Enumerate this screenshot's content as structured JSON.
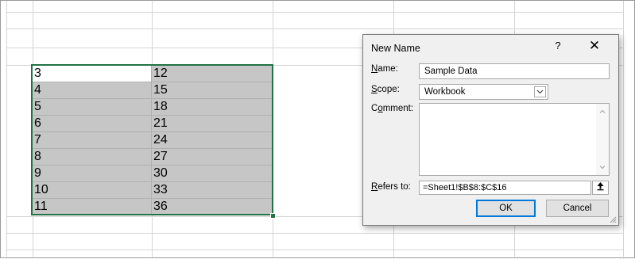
{
  "sheet": {
    "rows": [
      {
        "b": "3",
        "c": "12"
      },
      {
        "b": "4",
        "c": "15"
      },
      {
        "b": "5",
        "c": "18"
      },
      {
        "b": "6",
        "c": "21"
      },
      {
        "b": "7",
        "c": "24"
      },
      {
        "b": "8",
        "c": "27"
      },
      {
        "b": "9",
        "c": "30"
      },
      {
        "b": "10",
        "c": "33"
      },
      {
        "b": "11",
        "c": "36"
      }
    ]
  },
  "dialog": {
    "title": "New Name",
    "help": "?",
    "close": "✕",
    "name_label": "Name:",
    "name_value": "Sample Data",
    "scope_label": "Scope:",
    "scope_value": "Workbook",
    "comment_label": "Comment:",
    "comment_value": "",
    "refers_label": "Refers to:",
    "refers_value": "=Sheet1!$B$8:$C$16",
    "ok_label": "OK",
    "cancel_label": "Cancel"
  },
  "icons": {
    "dropdown": "chevron-down-icon",
    "collapse": "collapse-dialog-icon",
    "resize": "resize-grip-icon"
  },
  "colors": {
    "selection_border": "#217346",
    "range_fill": "#c6c6c6",
    "ok_border": "#0078d7",
    "dialog_bg": "#f0f0f0"
  }
}
